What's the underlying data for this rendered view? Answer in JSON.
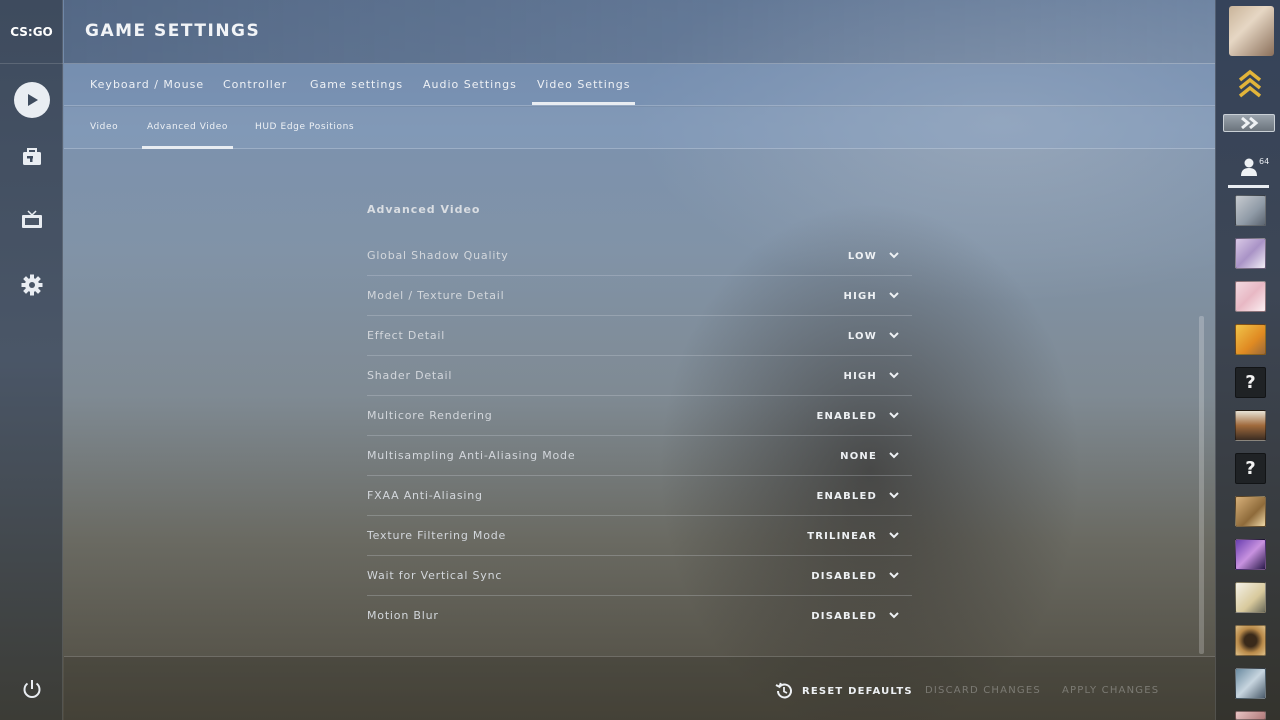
{
  "app": {
    "logo_text": "CS:GO",
    "title": "GAME SETTINGS"
  },
  "left_nav": {
    "items": [
      {
        "icon": "play-icon"
      },
      {
        "icon": "inventory-icon"
      },
      {
        "icon": "watch-tv-icon"
      },
      {
        "icon": "gear-icon"
      },
      {
        "icon": "power-icon"
      }
    ]
  },
  "tabs": [
    {
      "label": "Keyboard / Mouse",
      "active": false
    },
    {
      "label": "Controller",
      "active": false
    },
    {
      "label": "Game settings",
      "active": false
    },
    {
      "label": "Audio Settings",
      "active": false
    },
    {
      "label": "Video Settings",
      "active": true
    }
  ],
  "subtabs": [
    {
      "label": "Video",
      "active": false
    },
    {
      "label": "Advanced Video",
      "active": true
    },
    {
      "label": "HUD Edge Positions",
      "active": false
    }
  ],
  "section": {
    "title": "Advanced Video",
    "settings": [
      {
        "label": "Global Shadow Quality",
        "value": "LOW"
      },
      {
        "label": "Model / Texture Detail",
        "value": "HIGH"
      },
      {
        "label": "Effect Detail",
        "value": "LOW"
      },
      {
        "label": "Shader Detail",
        "value": "HIGH"
      },
      {
        "label": "Multicore Rendering",
        "value": "ENABLED"
      },
      {
        "label": "Multisampling Anti-Aliasing Mode",
        "value": "NONE"
      },
      {
        "label": "FXAA Anti-Aliasing",
        "value": "ENABLED"
      },
      {
        "label": "Texture Filtering Mode",
        "value": "TRILINEAR"
      },
      {
        "label": "Wait for Vertical Sync",
        "value": "DISABLED"
      },
      {
        "label": "Motion Blur",
        "value": "DISABLED"
      }
    ]
  },
  "footer": {
    "reset_label": "RESET DEFAULTS",
    "discard_label": "DISCARD CHANGES",
    "apply_label": "APPLY CHANGES"
  },
  "right_bar": {
    "friend_count": "64",
    "unknown_avatar_glyph": "?"
  },
  "colors": {
    "accent": "#e9edf2",
    "muted_button": "#8a8a85"
  }
}
